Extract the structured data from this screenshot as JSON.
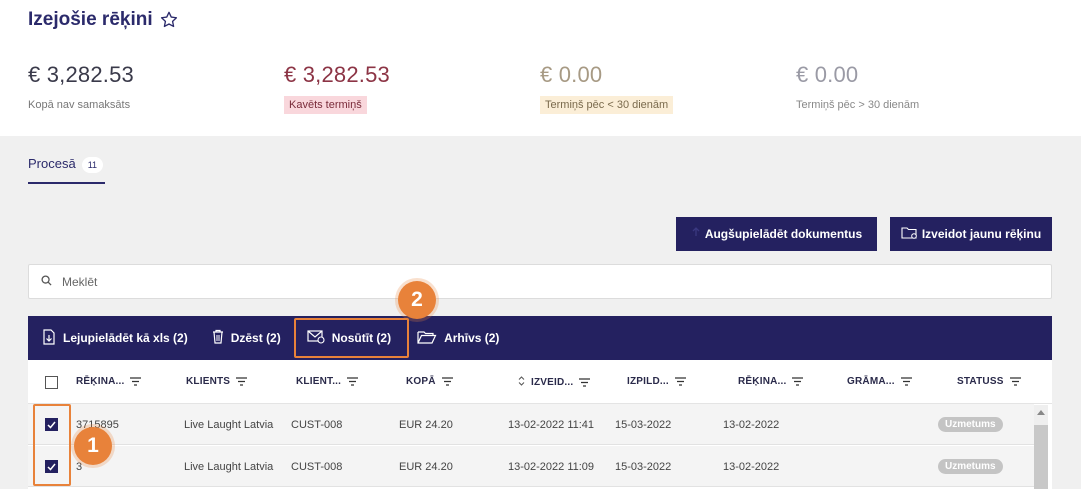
{
  "page": {
    "title": "Izejošie rēķini"
  },
  "stats": [
    {
      "amount": "€ 3,282.53",
      "label": "Kopā nav samaksāts"
    },
    {
      "amount": "€ 3,282.53",
      "label": "Kavēts termiņš"
    },
    {
      "amount": "€ 0.00",
      "label": "Termiņš pēc < 30 dienām"
    },
    {
      "amount": "€ 0.00",
      "label": "Termiņš pēc > 30 dienām"
    }
  ],
  "tabs": [
    {
      "label": "Procesā",
      "count": "11"
    }
  ],
  "buttons": {
    "upload": "Augšupielādēt dokumentus",
    "new_invoice": "Izveidot jaunu rēķinu"
  },
  "search": {
    "placeholder": "Meklēt"
  },
  "actions": {
    "download_xls": "Lejupielādēt kā xls (2)",
    "delete": "Dzēst (2)",
    "send": "Nosūtīt (2)",
    "archive": "Arhīvs (2)"
  },
  "annotations": {
    "badge1": "1",
    "badge2": "2"
  },
  "table": {
    "columns": [
      "RĒĶINA...",
      "KLIENTS",
      "KLIENT...",
      "KOPĀ",
      "IZVEID...",
      "IZPILD...",
      "RĒĶINA...",
      "GRĀMA...",
      "STATUSS"
    ],
    "rows": [
      {
        "number": "3715895",
        "client": "Live Laught Latvia",
        "client_id": "CUST-008",
        "total": "EUR 24.20",
        "created": "13-02-2022 11:41",
        "due": "15-03-2022",
        "invoice_date": "13-02-2022",
        "book": "",
        "status": "Uzmetums"
      },
      {
        "number": "3",
        "client": "Live Laught Latvia",
        "client_id": "CUST-008",
        "total": "EUR 24.20",
        "created": "13-02-2022 11:09",
        "due": "15-03-2022",
        "invoice_date": "13-02-2022",
        "book": "",
        "status": "Uzmetums"
      }
    ]
  },
  "colors": {
    "primary": "#242160",
    "accent_highlight": "#e8823a",
    "overdue_bg": "#f9d7dc",
    "soon_bg": "#fbeed7"
  }
}
